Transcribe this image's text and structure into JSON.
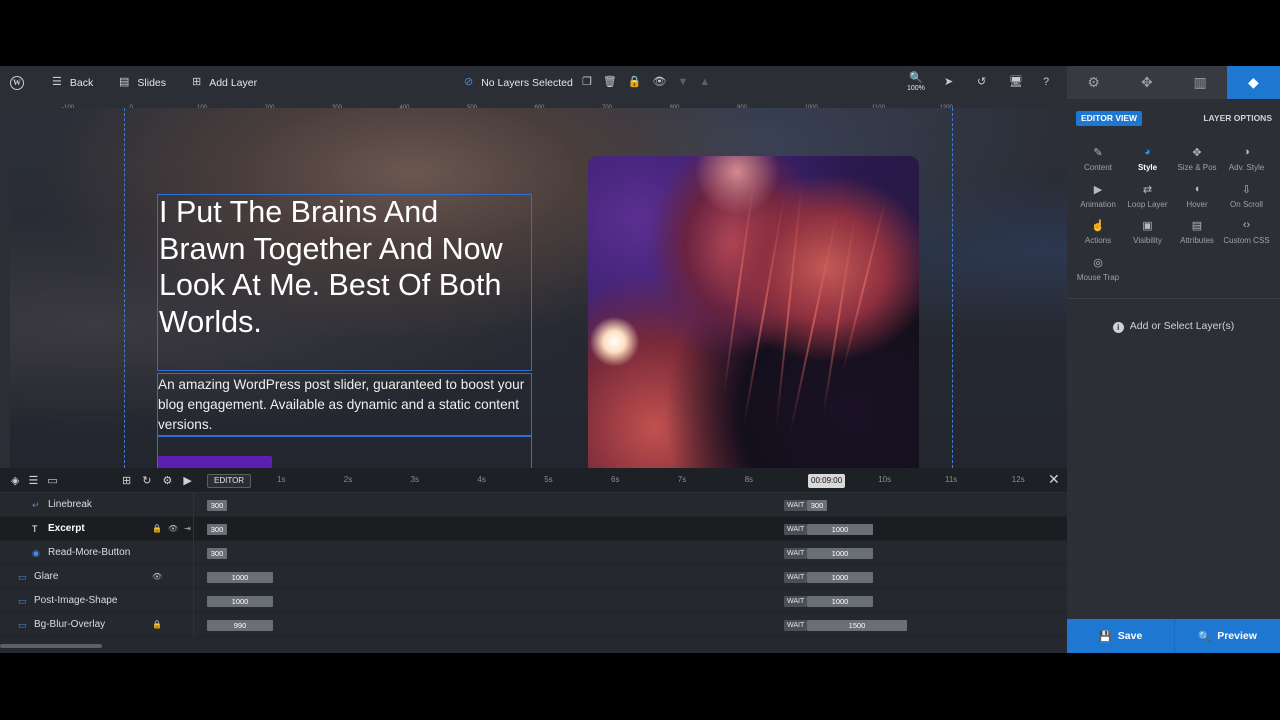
{
  "toolbar": {
    "back": "Back",
    "slides": "Slides",
    "add_layer": "Add Layer",
    "layer_status": "No Layers Selected",
    "zoom": "100%"
  },
  "ruler": {
    "h_ticks": [
      "-100",
      "0",
      "100",
      "200",
      "300",
      "400",
      "500",
      "600",
      "700",
      "800",
      "900",
      "1000",
      "1100",
      "1200"
    ]
  },
  "slide": {
    "headline": "I Put The Brains And Brawn Together And Now Look At Me. Best Of Both Worlds.",
    "excerpt": "An amazing WordPress post slider, guaranteed to boost your blog engagement. Available as dynamic and a static content versions."
  },
  "timeline": {
    "editor_badge": "EDITOR",
    "time_ticks": [
      "1s",
      "2s",
      "3s",
      "4s",
      "5s",
      "6s",
      "7s",
      "8s",
      "9s",
      "10s",
      "11s",
      "12s"
    ],
    "current_time": "00:09:00",
    "wait_label": "WAIT",
    "rows": [
      {
        "name": "Linebreak",
        "icon": "linebreak-icon",
        "in": "300",
        "out": "300"
      },
      {
        "name": "Excerpt",
        "icon": "text-icon",
        "in": "300",
        "out": "1000"
      },
      {
        "name": "Read-More-Button",
        "icon": "button-icon",
        "in": "300",
        "out": "1000"
      },
      {
        "name": "Glare",
        "icon": "shape-icon",
        "in": "1000",
        "out": "1000"
      },
      {
        "name": "Post-Image-Shape",
        "icon": "shape-icon",
        "in": "1000",
        "out": "1000"
      },
      {
        "name": "Bg-Blur-Overlay",
        "icon": "shape-icon",
        "in": "990",
        "out": "1500"
      }
    ]
  },
  "panel": {
    "editor_view": "EDITOR VIEW",
    "layer_options": "LAYER OPTIONS",
    "options": [
      "Content",
      "Style",
      "Size & Pos",
      "Adv. Style",
      "Animation",
      "Loop Layer",
      "Hover",
      "On Scroll",
      "Actions",
      "Visibility",
      "Attributes",
      "Custom CSS",
      "Mouse Trap"
    ],
    "active_option": "Style",
    "add_select": "Add or Select Layer(s)",
    "save": "Save",
    "preview": "Preview"
  },
  "colors": {
    "accent": "#1e78d2",
    "button": "#5b1fb2",
    "guide": "#3a7de0"
  }
}
